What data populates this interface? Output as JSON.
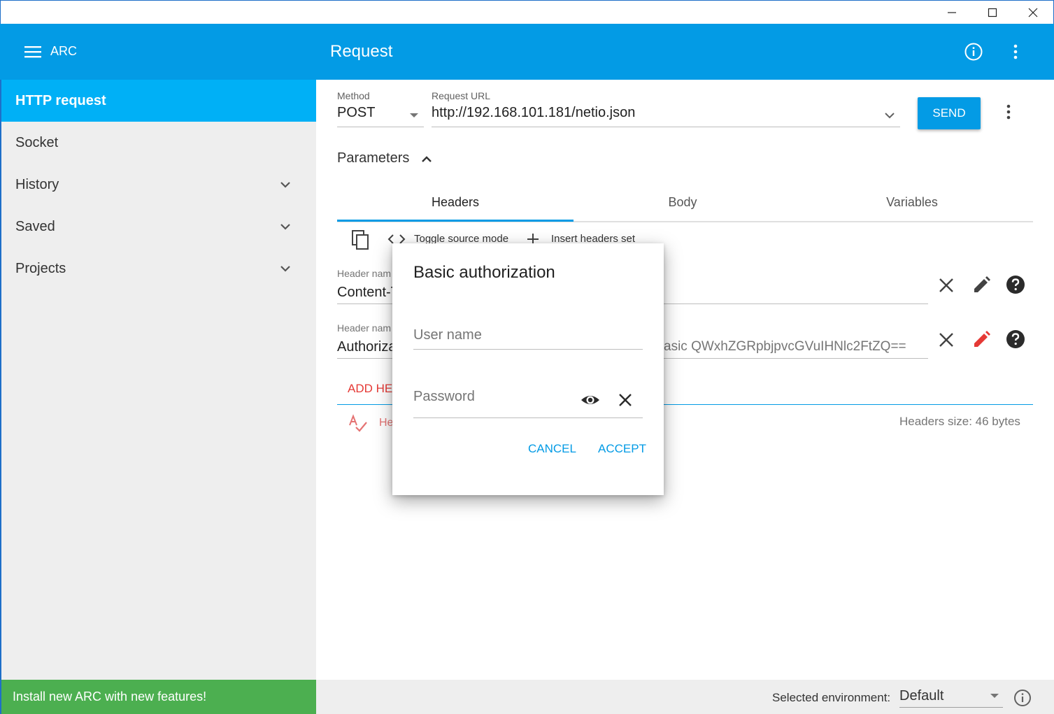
{
  "window": {
    "minimize_icon": "minimize-icon",
    "maximize_icon": "maximize-icon",
    "close_icon": "close-icon"
  },
  "appbar": {
    "app_name": "ARC",
    "page_title": "Request",
    "color": "#039be5"
  },
  "sidebar": {
    "items": [
      {
        "label": "HTTP request",
        "active": true
      },
      {
        "label": "Socket"
      },
      {
        "label": "History",
        "expandable": true
      },
      {
        "label": "Saved",
        "expandable": true
      },
      {
        "label": "Projects",
        "expandable": true
      }
    ],
    "install_banner": "Install new ARC with new features!",
    "banner_color": "#4caf50"
  },
  "request": {
    "method_label": "Method",
    "method_value": "POST",
    "url_label": "Request URL",
    "url_value": "http://192.168.101.181/netio.json",
    "send_label": "SEND",
    "parameters_label": "Parameters"
  },
  "tabs": [
    {
      "label": "Headers",
      "active": true
    },
    {
      "label": "Body"
    },
    {
      "label": "Variables"
    }
  ],
  "headers_toolbar": {
    "toggle_source": "Toggle source mode",
    "insert_set": "Insert headers set"
  },
  "header_rows": [
    {
      "name_label": "Header nam",
      "name_value": "Content-T",
      "value": ""
    },
    {
      "name_label": "Header nam",
      "name_value": "Authoriza",
      "value": "asic QWxhZGRpbjpvcGVuIHNlc2FtZQ=="
    }
  ],
  "add_header": "ADD HEA",
  "spell_hint": "He",
  "headers_size": "Headers size: 46 bytes",
  "status": {
    "env_label": "Selected environment:",
    "env_value": "Default"
  },
  "dialog": {
    "title": "Basic authorization",
    "username_placeholder": "User name",
    "password_placeholder": "Password",
    "cancel": "CANCEL",
    "accept": "ACCEPT"
  }
}
